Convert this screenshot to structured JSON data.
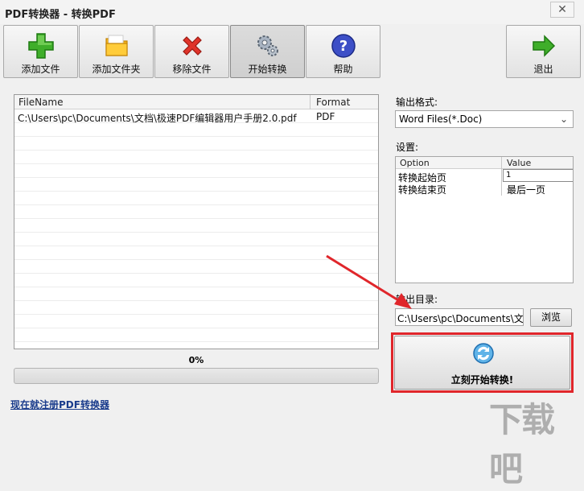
{
  "window": {
    "title": "PDF转换器 - 转换PDF",
    "close_label": "✕"
  },
  "toolbar": {
    "add_file": "添加文件",
    "add_folder": "添加文件夹",
    "remove_file": "移除文件",
    "start_convert": "开始转换",
    "help": "帮助",
    "exit": "退出"
  },
  "file_list": {
    "columns": [
      "FileName",
      "Format"
    ],
    "rows": [
      {
        "filename": "C:\\Users\\pc\\Documents\\文档\\极速PDF编辑器用户手册2.0.pdf",
        "format": "PDF"
      }
    ]
  },
  "progress": {
    "label": "0%",
    "value": 0
  },
  "register_link": "现在就注册PDF转换器",
  "output_format": {
    "label": "输出格式:",
    "selected": "Word Files(*.Doc)"
  },
  "settings": {
    "label": "设置:",
    "columns": [
      "Option",
      "Value"
    ],
    "rows": [
      {
        "option": "转换起始页",
        "value": "1"
      },
      {
        "option": "转换结束页",
        "value": "最后一页"
      }
    ]
  },
  "output_dir": {
    "label": "输出目录:",
    "value": "C:\\Users\\pc\\Documents\\文档",
    "browse": "浏览"
  },
  "convert_button": "立刻开始转换!",
  "watermark": "下载吧",
  "colors": {
    "highlight": "#e0262b",
    "link": "#1a3c8c"
  }
}
